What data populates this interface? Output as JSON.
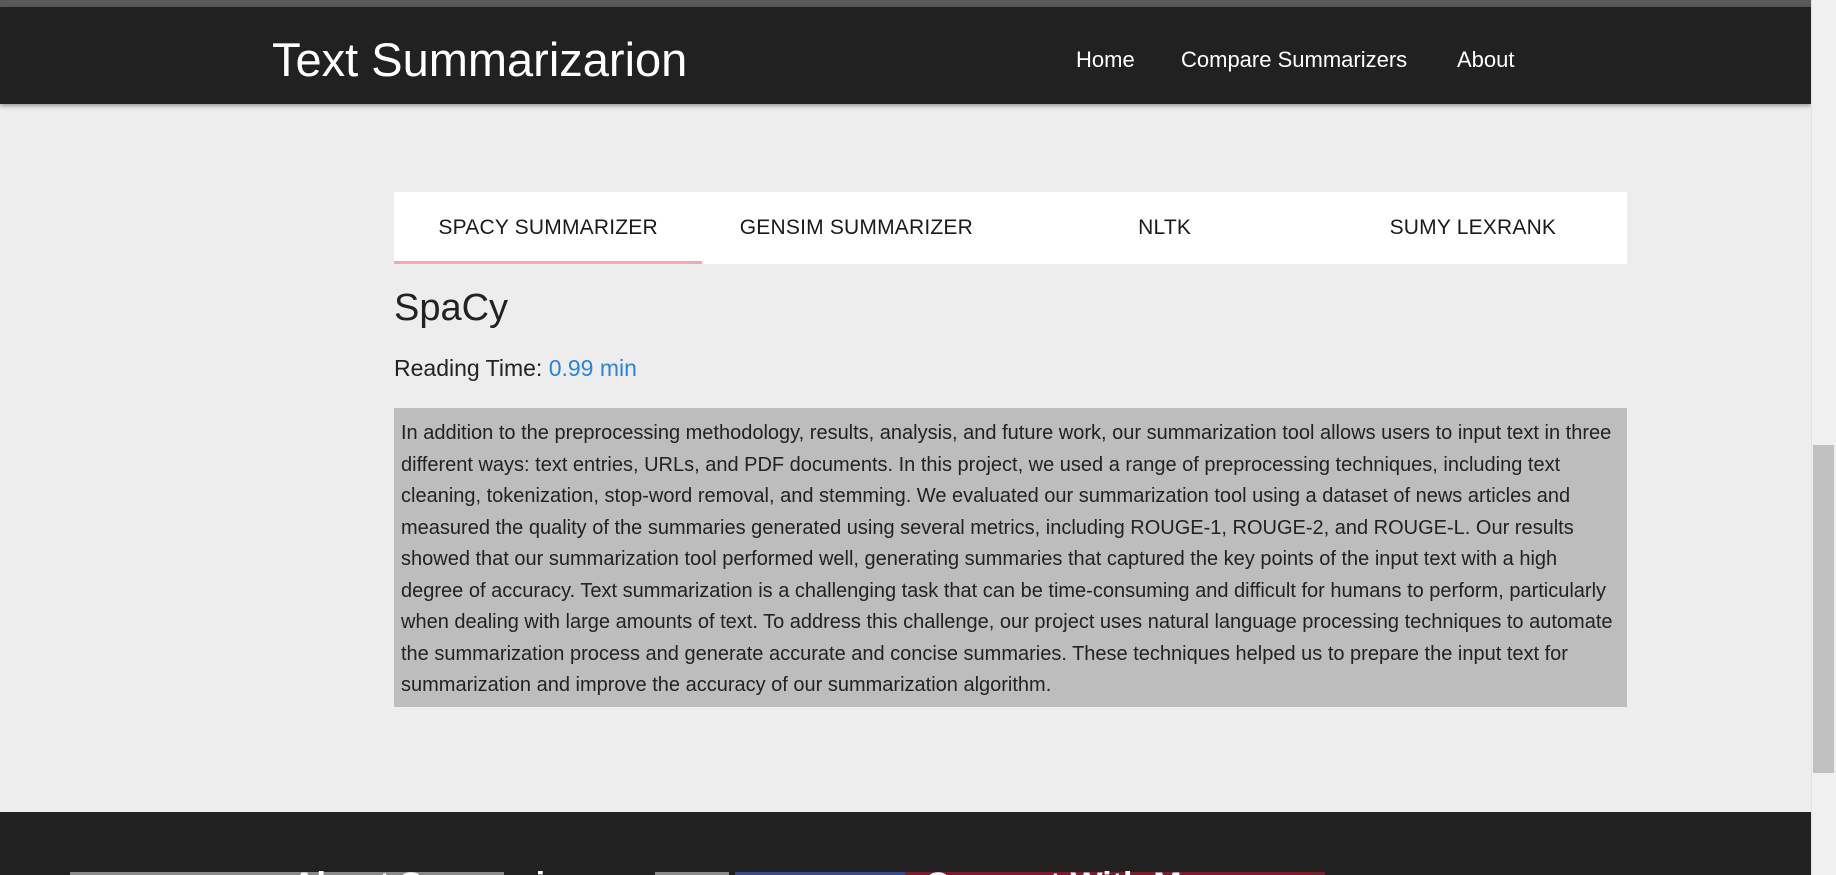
{
  "navbar": {
    "brand": "Text Summarizarion",
    "links": [
      "Home",
      "Compare Summarizers",
      "About"
    ]
  },
  "tabs": {
    "items": [
      "SPACY SUMMARIZER",
      "GENSIM SUMMARIZER",
      "NLTK",
      "SUMY LEXRANK"
    ],
    "active_index": 0
  },
  "main": {
    "title": "SpaCy",
    "reading_label": "Reading Time:",
    "reading_value": "0.99 min",
    "summary": "In addition to the preprocessing methodology, results, analysis, and future work, our summarization tool allows users to input text in three different ways: text entries, URLs, and PDF documents. In this project, we used a range of preprocessing techniques, including text cleaning, tokenization, stop-word removal, and stemming. We evaluated our summarization tool using a dataset of news articles and measured the quality of the summaries generated using several metrics, including ROUGE-1, ROUGE-2, and ROUGE-L. Our results showed that our summarization tool performed well, generating summaries that captured the key points of the input text with a high degree of accuracy. Text summarization is a challenging task that can be time-consuming and difficult for humans to perform, particularly when dealing with large amounts of text. To address this challenge, our project uses natural language processing techniques to automate the summarization process and generate accurate and concise summaries. These techniques helped us to prepare the input text for summarization and improve the accuracy of our summarization algorithm."
  },
  "footer": {
    "headings": [
      "About Summarizer",
      "Connect With Me"
    ]
  },
  "colors": {
    "navbar_bg": "#212121",
    "page_bg": "#ededed",
    "accent_link": "#2a84d8",
    "active_tab_underline": "#f3a9b3",
    "summary_bg": "#bdbdbd"
  },
  "scroll": {
    "position_fraction": 0.66
  }
}
